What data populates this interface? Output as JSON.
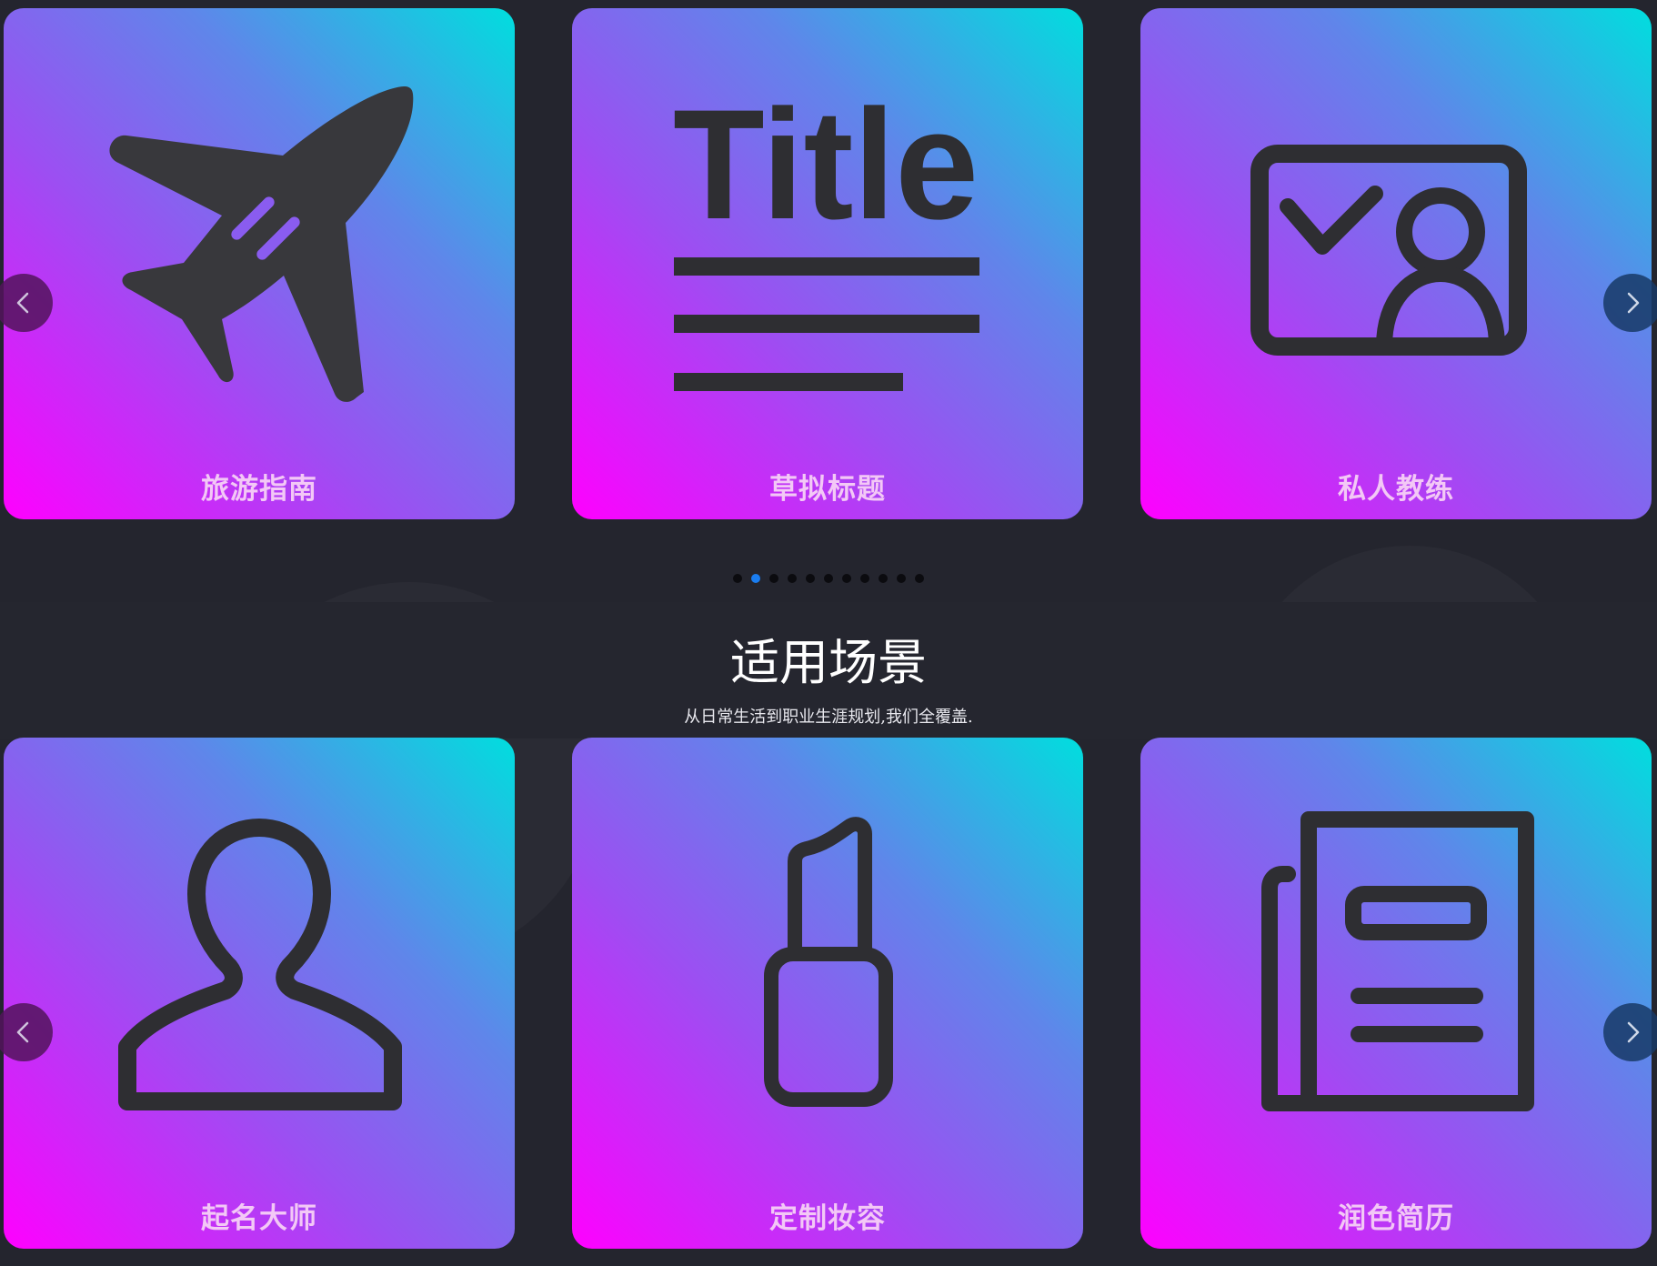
{
  "top_carousel": {
    "cards": [
      {
        "label": "旅游指南",
        "icon": "airplane-icon"
      },
      {
        "label": "草拟标题",
        "icon": "title-document-icon"
      },
      {
        "label": "私人教练",
        "icon": "id-card-check-icon"
      }
    ],
    "prev_icon": "chevron-left-icon",
    "next_icon": "chevron-right-icon",
    "title_icon_text": "Title",
    "pagination": {
      "total": 11,
      "active_index": 1
    }
  },
  "section": {
    "title": "适用场景",
    "subtitle": "从日常生活到职业生涯规划,我们全覆盖."
  },
  "bottom_carousel": {
    "cards": [
      {
        "label": "起名大师",
        "icon": "user-silhouette-icon"
      },
      {
        "label": "定制妆容",
        "icon": "lipstick-icon"
      },
      {
        "label": "润色简历",
        "icon": "newspaper-icon"
      }
    ],
    "prev_icon": "chevron-left-icon",
    "next_icon": "chevron-right-icon"
  },
  "colors": {
    "background": "#24252e",
    "card_gradient_start": "#ff00ff",
    "card_gradient_end": "#00dede",
    "icon": "#2e2e32",
    "card_label": "#f3c8f6",
    "dot": "#0b0b0f",
    "dot_active": "#1a7df0"
  }
}
